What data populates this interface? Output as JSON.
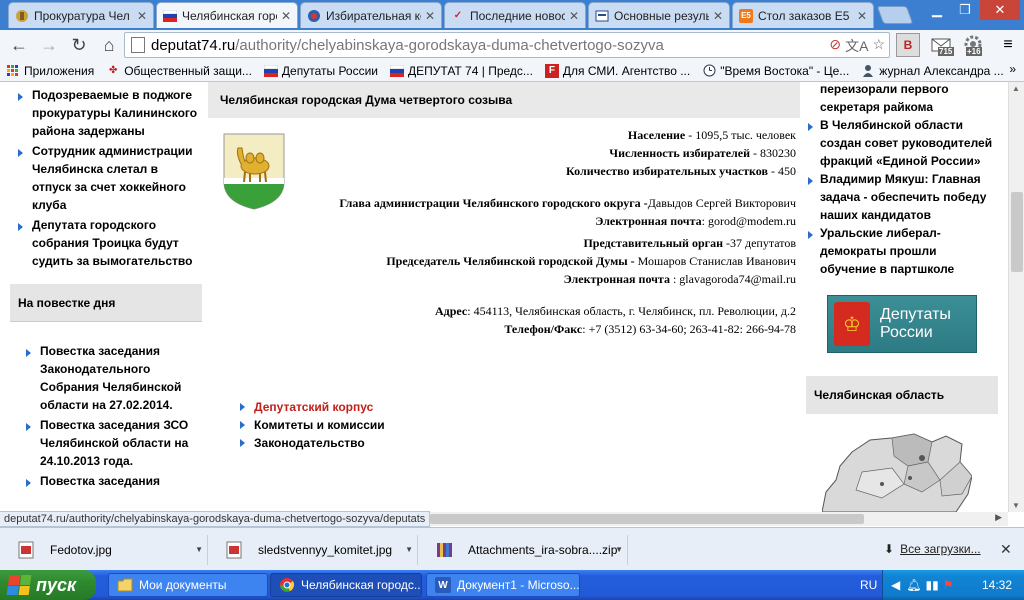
{
  "tabs": [
    {
      "title": "Прокуратура Чел",
      "icon": "eagle-emblem-icon"
    },
    {
      "title": "Челябинская горо",
      "icon": "russia-flag-icon",
      "active": true
    },
    {
      "title": "Избирательная ко",
      "icon": "election-emblem-icon"
    },
    {
      "title": "Последние новос",
      "icon": "news-check-icon"
    },
    {
      "title": "Основные резуль",
      "icon": "results-icon"
    },
    {
      "title": "Стол заказов E5",
      "icon": "e5-icon"
    }
  ],
  "address": {
    "host": "deputat74.ru",
    "path": "/authority/chelyabinskaya-gorodskaya-duma-chetvertogo-sozyva"
  },
  "extensions": {
    "badge_mail": "715",
    "badge_gear": "+16"
  },
  "bookmarks": [
    {
      "label": "Приложения",
      "icon": "apps-grid-icon"
    },
    {
      "label": "Общественный защи...",
      "icon": "bookmark-icon"
    },
    {
      "label": "Депутаты России",
      "icon": "flag-icon"
    },
    {
      "label": "ДЕПУТАТ 74 | Предс...",
      "icon": "flag-icon"
    },
    {
      "label": "Для СМИ. Агентство ...",
      "icon": "f-icon"
    },
    {
      "label": "\"Время Востока\" - Це...",
      "icon": "clock-icon"
    },
    {
      "label": "журнал Александра ...",
      "icon": "user-icon"
    }
  ],
  "bookmarks_more": "»",
  "left_news": [
    "Подозреваемые в поджоге прокуратуры Калининского района задержаны",
    "Сотрудник администрации Челябинска слетал в отпуск за счет хоккейного клуба",
    "Депутата городского собрания Троицка будут судить за вымогательство"
  ],
  "agenda": {
    "heading": "На повестке дня",
    "items": [
      "Повестка заседания Законодательного Собрания Челябинской области на 27.02.2014.",
      "Повестка заседания ЗСО Челябинской области на 24.10.2013 года.",
      "Повестка заседания"
    ]
  },
  "main": {
    "heading": "Челябинская городская Дума четвертого созыва",
    "population_label": "Население",
    "population_value": " - 1095,5 тыс. человек",
    "voters_label": "Численность избирателей",
    "voters_value": " - 830230",
    "districts_label": "Количество избирательных участков",
    "districts_value": " - 450",
    "head_label": "Глава администрации Челябинского городского округа -",
    "head_value": "Давыдов Сергей Викторович",
    "head_email_label": "Электронная почта",
    "head_email_value": ": gorod@modem.ru",
    "rep_label": "Представительный орган",
    "rep_value": "  -37 депутатов",
    "chair_label": "Председатель Челябинской городской Думы -",
    "chair_value": "  Мошаров Станислав  Иванович",
    "chair_email_label": "Электронная почта",
    "chair_email_value": " : glavagoroda74@mail.ru",
    "address_label": "Адрес",
    "address_value": ": 454113, Челябинская область, г. Челябинск, пл. Революции, д.2",
    "phone_label": "Телефон/Факс",
    "phone_value": ": +7 (3512) 63-34-60; 263-41-82: 266-94-78",
    "links": [
      "Депутатский корпус",
      "Комитеты и комиссии",
      "Законодательство"
    ]
  },
  "right_news": [
    {
      "text": "переизорали первого секретаря райкома",
      "bullet": false
    },
    {
      "text": "В Челябинской области создан совет руководителей фракций «Единой России»",
      "bullet": true
    },
    {
      "text": "Владимир Мякуш: Главная задача - обеспечить победу наших кандидатов",
      "bullet": true
    },
    {
      "text": "Уральские либерал-демократы прошли обучение в партшколе",
      "bullet": true
    }
  ],
  "banner": {
    "line1": "Депутаты",
    "line2": "России"
  },
  "region_heading": "Челябинская область",
  "status_url": "deputat74.ru/authority/chelyabinskaya-gorodskaya-duma-chetvertogo-sozyva/deputats",
  "downloads": [
    {
      "name": "Fedotov.jpg",
      "icon": "image-file-icon"
    },
    {
      "name": "sledstvennyy_komitet.jpg",
      "icon": "image-file-icon"
    },
    {
      "name": "Attachments_ira-sobra....zip",
      "icon": "archive-file-icon"
    }
  ],
  "all_downloads": "Все загрузки...",
  "taskbar": {
    "start": "пуск",
    "tasks": [
      {
        "label": "Мои документы",
        "icon": "folder-icon"
      },
      {
        "label": "Челябинская городс...",
        "icon": "chrome-icon"
      },
      {
        "label": "Документ1 - Microso...",
        "icon": "word-icon"
      }
    ],
    "lang": "RU",
    "clock": "14:32"
  }
}
